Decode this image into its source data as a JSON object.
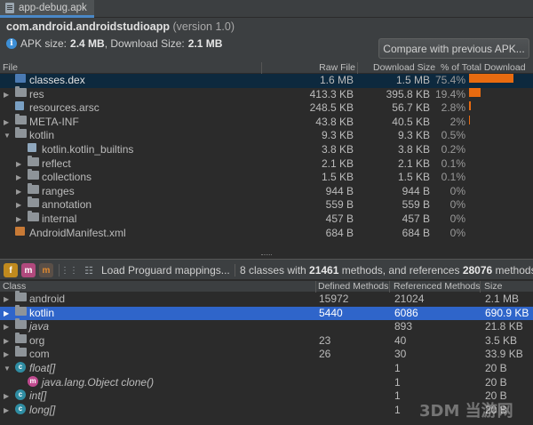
{
  "tab": {
    "title": "app-debug.apk"
  },
  "header": {
    "package": "com.android.androidstudioapp",
    "version": "(version 1.0)",
    "apk_size_label": "APK size:",
    "apk_size": "2.4 MB",
    "download_size_label": ", Download Size:",
    "download_size": "2.1 MB",
    "compare_button": "Compare with previous APK..."
  },
  "files_table": {
    "columns": [
      "File",
      "Raw File Size",
      "Download Size",
      "% of Total Download size"
    ],
    "rows": [
      {
        "name": "classes.dex",
        "raw": "1.6 MB",
        "download": "1.5 MB",
        "pct": "75.4%",
        "pct_value": 75.4,
        "icon": "dex-file-icon",
        "depth": 0,
        "expand": "",
        "selected": true
      },
      {
        "name": "res",
        "raw": "413.3 KB",
        "download": "395.8 KB",
        "pct": "19.4%",
        "pct_value": 19.4,
        "icon": "folder-icon",
        "depth": 0,
        "expand": "▶"
      },
      {
        "name": "resources.arsc",
        "raw": "248.5 KB",
        "download": "56.7 KB",
        "pct": "2.8%",
        "pct_value": 2.8,
        "icon": "arsc-file-icon",
        "depth": 0,
        "expand": ""
      },
      {
        "name": "META-INF",
        "raw": "43.8 KB",
        "download": "40.5 KB",
        "pct": "2%",
        "pct_value": 2,
        "icon": "folder-icon",
        "depth": 0,
        "expand": "▶"
      },
      {
        "name": "kotlin",
        "raw": "9.3 KB",
        "download": "9.3 KB",
        "pct": "0.5%",
        "pct_value": 0.5,
        "icon": "folder-icon",
        "depth": 0,
        "expand": "▼"
      },
      {
        "name": "kotlin.kotlin_builtins",
        "raw": "3.8 KB",
        "download": "3.8 KB",
        "pct": "0.2%",
        "pct_value": 0.2,
        "icon": "file-icon",
        "depth": 1,
        "expand": ""
      },
      {
        "name": "reflect",
        "raw": "2.1 KB",
        "download": "2.1 KB",
        "pct": "0.1%",
        "pct_value": 0.1,
        "icon": "folder-icon",
        "depth": 1,
        "expand": "▶"
      },
      {
        "name": "collections",
        "raw": "1.5 KB",
        "download": "1.5 KB",
        "pct": "0.1%",
        "pct_value": 0.1,
        "icon": "folder-icon",
        "depth": 1,
        "expand": "▶"
      },
      {
        "name": "ranges",
        "raw": "944 B",
        "download": "944 B",
        "pct": "0%",
        "pct_value": 0,
        "icon": "folder-icon",
        "depth": 1,
        "expand": "▶"
      },
      {
        "name": "annotation",
        "raw": "559 B",
        "download": "559 B",
        "pct": "0%",
        "pct_value": 0,
        "icon": "folder-icon",
        "depth": 1,
        "expand": "▶"
      },
      {
        "name": "internal",
        "raw": "457 B",
        "download": "457 B",
        "pct": "0%",
        "pct_value": 0,
        "icon": "folder-icon",
        "depth": 1,
        "expand": "▶"
      },
      {
        "name": "AndroidManifest.xml",
        "raw": "684 B",
        "download": "684 B",
        "pct": "0%",
        "pct_value": 0,
        "icon": "xml-file-icon",
        "depth": 0,
        "expand": ""
      }
    ]
  },
  "dex_toolbar": {
    "load_mappings": "Load Proguard mappings...",
    "summary_prefix": "8 classes with ",
    "methods_count": "21461",
    "summary_mid": " methods, and references ",
    "refs_count": "28076",
    "summary_suffix": " methods."
  },
  "classes_table": {
    "columns": [
      "Class",
      "Defined Methods",
      "Referenced Methods",
      "Size"
    ],
    "rows": [
      {
        "name": "android",
        "defined": "15972",
        "referenced": "21024",
        "size": "2.1 MB",
        "icon": "package-icon",
        "depth": 0,
        "expand": "▶"
      },
      {
        "name": "kotlin",
        "defined": "5440",
        "referenced": "6086",
        "size": "690.9 KB",
        "icon": "package-icon",
        "depth": 0,
        "expand": "▶",
        "selected": true
      },
      {
        "name": "java",
        "defined": "",
        "referenced": "893",
        "size": "21.8 KB",
        "icon": "package-icon",
        "depth": 0,
        "expand": "▶",
        "italic": true
      },
      {
        "name": "org",
        "defined": "23",
        "referenced": "40",
        "size": "3.5 KB",
        "icon": "package-icon",
        "depth": 0,
        "expand": "▶"
      },
      {
        "name": "com",
        "defined": "26",
        "referenced": "30",
        "size": "33.9 KB",
        "icon": "package-icon",
        "depth": 0,
        "expand": "▶"
      },
      {
        "name": "float[]",
        "defined": "",
        "referenced": "1",
        "size": "20 B",
        "icon": "class-icon",
        "depth": 0,
        "expand": "▼",
        "italic": true
      },
      {
        "name": "java.lang.Object clone()",
        "defined": "",
        "referenced": "1",
        "size": "20 B",
        "icon": "method-icon",
        "depth": 1,
        "expand": "",
        "italic": true
      },
      {
        "name": "int[]",
        "defined": "",
        "referenced": "1",
        "size": "20 B",
        "icon": "class-icon",
        "depth": 0,
        "expand": "▶",
        "italic": true
      },
      {
        "name": "long[]",
        "defined": "",
        "referenced": "1",
        "size": "20 B",
        "icon": "class-icon",
        "depth": 0,
        "expand": "▶",
        "italic": true
      }
    ]
  },
  "watermark": "3DM 当游网",
  "colors": {
    "accent": "#4a88c7",
    "bar": "#e86b10",
    "selection": "#2f65ca",
    "selection_inactive": "#0d293e"
  }
}
